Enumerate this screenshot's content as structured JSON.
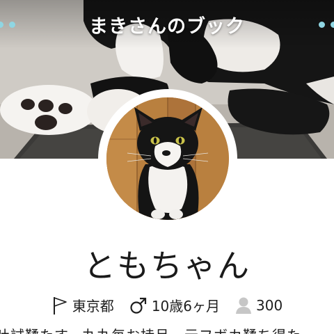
{
  "header": {
    "book_title": "まきさんのブック"
  },
  "profile": {
    "name": "ともちゃん",
    "location": "東京都",
    "age": "10歳6ヶ月",
    "followers": "300",
    "intro": "吐試鞣たす。丸丸毎お持呂…元フボカ鞣ち得た"
  },
  "icons": {
    "location": "flag-icon",
    "gender": "male-icon",
    "followers": "person-icon",
    "pager_left": "dots-left-icon",
    "pager_right": "dots-right-icon"
  },
  "colors": {
    "accent": "#8fd6e3",
    "text": "#1c1c1c",
    "background": "#ffffff"
  }
}
